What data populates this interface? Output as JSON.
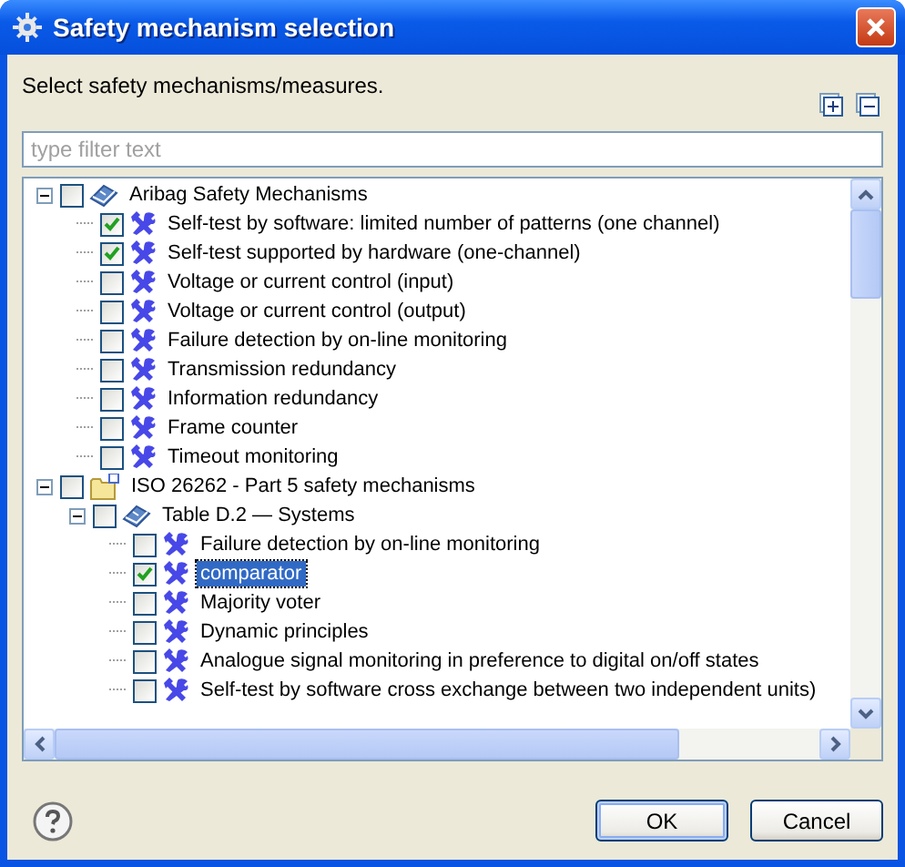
{
  "window": {
    "title": "Safety mechanism selection"
  },
  "instruction": "Select safety mechanisms/measures.",
  "filter": {
    "placeholder": "type filter text"
  },
  "tree": [
    {
      "label": "Aribag Safety Mechanisms",
      "kind": "book",
      "checked": false,
      "expanded": true,
      "selected": false,
      "children": [
        {
          "label": "Self-test by software: limited number of patterns (one channel)",
          "kind": "tool",
          "checked": true,
          "selected": false
        },
        {
          "label": "Self-test supported by hardware (one-channel)",
          "kind": "tool",
          "checked": true,
          "selected": false
        },
        {
          "label": "Voltage or current control (input)",
          "kind": "tool",
          "checked": false,
          "selected": false
        },
        {
          "label": "Voltage or current control (output)",
          "kind": "tool",
          "checked": false,
          "selected": false
        },
        {
          "label": "Failure detection by on-line monitoring",
          "kind": "tool",
          "checked": false,
          "selected": false
        },
        {
          "label": "Transmission redundancy",
          "kind": "tool",
          "checked": false,
          "selected": false
        },
        {
          "label": "Information redundancy",
          "kind": "tool",
          "checked": false,
          "selected": false
        },
        {
          "label": "Frame counter",
          "kind": "tool",
          "checked": false,
          "selected": false
        },
        {
          "label": "Timeout monitoring",
          "kind": "tool",
          "checked": false,
          "selected": false
        }
      ]
    },
    {
      "label": "ISO 26262 - Part 5 safety mechanisms",
      "kind": "folder",
      "checked": false,
      "expanded": true,
      "selected": false,
      "children": [
        {
          "label": "Table D.2 — Systems",
          "kind": "book",
          "checked": false,
          "expanded": true,
          "selected": false,
          "children": [
            {
              "label": "Failure detection by on-line monitoring",
              "kind": "tool",
              "checked": false,
              "selected": false
            },
            {
              "label": "comparator",
              "kind": "tool",
              "checked": true,
              "selected": true
            },
            {
              "label": "Majority voter",
              "kind": "tool",
              "checked": false,
              "selected": false
            },
            {
              "label": "Dynamic principles",
              "kind": "tool",
              "checked": false,
              "selected": false
            },
            {
              "label": "Analogue signal monitoring in preference to digital on/off states",
              "kind": "tool",
              "checked": false,
              "selected": false
            },
            {
              "label": "Self-test by software cross exchange between two independent units)",
              "kind": "tool",
              "checked": false,
              "selected": false
            }
          ]
        }
      ]
    }
  ],
  "buttons": [
    "OK",
    "Cancel"
  ]
}
